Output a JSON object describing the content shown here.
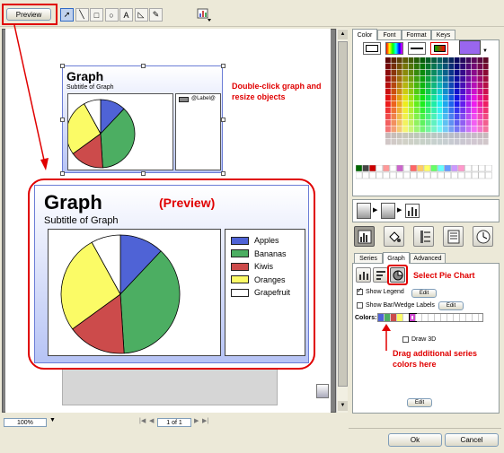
{
  "toolbar": {
    "preview_label": "Preview",
    "tools": [
      "pointer-tool-icon",
      "line-tool-icon",
      "rectangle-tool-icon",
      "ellipse-tool-icon",
      "text-tool-icon",
      "polygon-tool-icon",
      "pencil-tool-icon"
    ],
    "insert_icon": "insert-graph-icon"
  },
  "canvas": {
    "small_graph": {
      "title": "Graph",
      "subtitle": "Subtitle of Graph",
      "legend_label": "@Label@"
    },
    "preview_graph": {
      "title": "Graph",
      "subtitle": "Subtitle of Graph",
      "badge": "(Preview)"
    }
  },
  "chart_data": {
    "type": "pie",
    "categories": [
      "Apples",
      "Bananas",
      "Kiwis",
      "Oranges",
      "Grapefruit"
    ],
    "values": [
      12,
      37,
      16,
      27,
      8
    ],
    "colors": [
      "#4f63d6",
      "#4cae62",
      "#cc4b4b",
      "#fbfb66",
      "#ffffff"
    ],
    "title": "Graph",
    "subtitle": "Subtitle of Graph",
    "legend_position": "right"
  },
  "annotations": {
    "resize_note": "Double-click graph and resize objects",
    "select_pie": "Select Pie Chart",
    "drag_colors": "Drag additional series colors here"
  },
  "statusbar": {
    "zoom": "100%",
    "page": "1 of 1"
  },
  "color_panel": {
    "tabs": [
      "Color",
      "Font",
      "Format",
      "Keys"
    ],
    "active_tab": "Color",
    "selected_color": "#9966ee"
  },
  "graph_panel": {
    "tabs": [
      "Series",
      "Graph",
      "Advanced"
    ],
    "active_tab": "Graph",
    "show_legend_label": "Show Legend",
    "show_legend_checked": true,
    "show_labels_label": "Show Bar/Wedge Labels",
    "show_labels_checked": false,
    "edit_label": "Edit",
    "colors_label": "Colors:",
    "series_colors": [
      "#4f63d6",
      "#4cae62",
      "#cc4b4b",
      "#fbfb66",
      "#ffffff",
      "#cc44cc"
    ],
    "draw3d_label": "Draw 3D",
    "draw3d_checked": false
  },
  "dialog": {
    "ok_label": "Ok",
    "cancel_label": "Cancel"
  }
}
